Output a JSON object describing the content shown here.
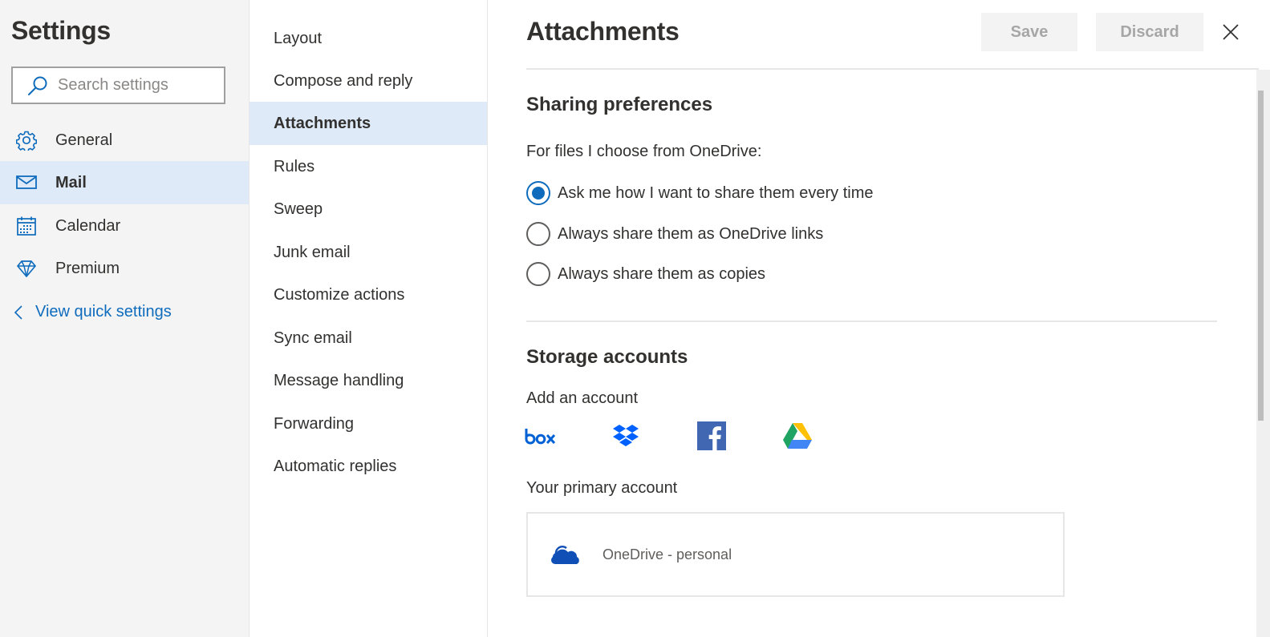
{
  "sidebar": {
    "title": "Settings",
    "search": {
      "placeholder": "Search settings",
      "value": "",
      "icon": "search-icon"
    },
    "categories": [
      {
        "label": "General",
        "icon": "gear-icon",
        "selected": false
      },
      {
        "label": "Mail",
        "icon": "mail-icon",
        "selected": true
      },
      {
        "label": "Calendar",
        "icon": "calendar-icon",
        "selected": false
      },
      {
        "label": "Premium",
        "icon": "diamond-icon",
        "selected": false
      }
    ],
    "quick_settings_link": "View quick settings"
  },
  "subnav": {
    "items": [
      {
        "label": "Layout",
        "selected": false
      },
      {
        "label": "Compose and reply",
        "selected": false
      },
      {
        "label": "Attachments",
        "selected": true
      },
      {
        "label": "Rules",
        "selected": false
      },
      {
        "label": "Sweep",
        "selected": false
      },
      {
        "label": "Junk email",
        "selected": false
      },
      {
        "label": "Customize actions",
        "selected": false
      },
      {
        "label": "Sync email",
        "selected": false
      },
      {
        "label": "Message handling",
        "selected": false
      },
      {
        "label": "Forwarding",
        "selected": false
      },
      {
        "label": "Automatic replies",
        "selected": false
      }
    ]
  },
  "panel": {
    "title": "Attachments",
    "save_label": "Save",
    "discard_label": "Discard",
    "close_icon": "close-icon",
    "sharing": {
      "title": "Sharing preferences",
      "prompt": "For files I choose from OneDrive:",
      "options": [
        {
          "label": "Ask me how I want to share them every time",
          "checked": true
        },
        {
          "label": "Always share them as OneDrive links",
          "checked": false
        },
        {
          "label": "Always share them as copies",
          "checked": false
        }
      ]
    },
    "storage": {
      "title": "Storage accounts",
      "add_label": "Add an account",
      "providers": [
        {
          "name": "Box",
          "icon": "box-icon",
          "color": "#0061d5"
        },
        {
          "name": "Dropbox",
          "icon": "dropbox-icon",
          "color": "#0061fe"
        },
        {
          "name": "Facebook",
          "icon": "facebook-icon",
          "color": "#4267b2"
        },
        {
          "name": "Google Drive",
          "icon": "google-drive-icon",
          "color": "#1fa463"
        }
      ],
      "primary_label": "Your primary account",
      "primary_account": {
        "name": "OneDrive - personal",
        "icon": "onedrive-icon",
        "color": "#0f4fb6"
      }
    }
  },
  "colors": {
    "accent": "#0f6cbd",
    "selected_bg": "#deeaf7",
    "sidebar_bg": "#f4f4f4"
  }
}
